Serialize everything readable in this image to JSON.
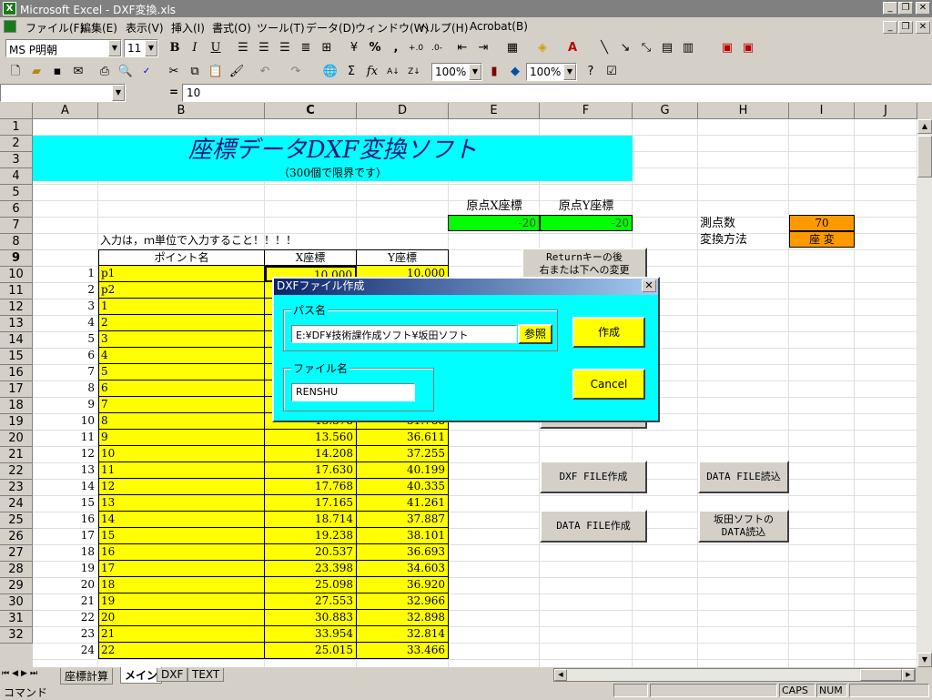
{
  "window": {
    "title": "Microsoft Excel - DXF変換.xls",
    "app_icon": "X"
  },
  "menu": [
    "ファイル(F)",
    "編集(E)",
    "表示(V)",
    "挿入(I)",
    "書式(O)",
    "ツール(T)",
    "データ(D)",
    "ウィンドウ(W)",
    "ヘルプ(H)",
    "Acrobat(B)"
  ],
  "format_toolbar": {
    "font": "MS P明朝",
    "size": "11"
  },
  "std_toolbar": {
    "zoom1": "100%",
    "zoom2": "100%"
  },
  "formula_bar": {
    "name_box": "",
    "equals": "=",
    "value": "10"
  },
  "columns": [
    "A",
    "B",
    "C",
    "D",
    "E",
    "F",
    "G",
    "H",
    "I",
    "J"
  ],
  "rows": [
    "1",
    "2",
    "3",
    "4",
    "5",
    "6",
    "7",
    "8",
    "9",
    "10",
    "11",
    "12",
    "13",
    "14",
    "15",
    "16",
    "17",
    "18",
    "19",
    "20",
    "21",
    "22",
    "23",
    "24",
    "25",
    "26",
    "27",
    "28",
    "29",
    "30",
    "31",
    "32"
  ],
  "sheet": {
    "title": "座標データDXF変換ソフト",
    "subtitle": "（300個で限界です）",
    "origin_x_label": "原点X座標",
    "origin_y_label": "原点Y座標",
    "origin_x": "-20",
    "origin_y": "-20",
    "point_count_label": "測点数",
    "point_count": "70",
    "method_label": "変換方法",
    "method": "座 変",
    "note": "入力は，ｍ単位で入力すること！！！！",
    "table_header": {
      "name": "ポイント名",
      "x": "X座標",
      "y": "Y座標"
    },
    "table_rows": [
      {
        "no": "1",
        "name": "p1",
        "x": "10.000",
        "y": "10.000"
      },
      {
        "no": "2",
        "name": "p2",
        "x": "",
        "y": ""
      },
      {
        "no": "3",
        "name": "1",
        "x": "",
        "y": ""
      },
      {
        "no": "4",
        "name": "2",
        "x": "",
        "y": ""
      },
      {
        "no": "5",
        "name": "3",
        "x": "",
        "y": ""
      },
      {
        "no": "6",
        "name": "4",
        "x": "",
        "y": ""
      },
      {
        "no": "7",
        "name": "5",
        "x": "",
        "y": ""
      },
      {
        "no": "8",
        "name": "6",
        "x": "",
        "y": ""
      },
      {
        "no": "9",
        "name": "7",
        "x": "",
        "y": ""
      },
      {
        "no": "10",
        "name": "8",
        "x": "13.378",
        "y": "31.788"
      },
      {
        "no": "11",
        "name": "9",
        "x": "13.560",
        "y": "36.611"
      },
      {
        "no": "12",
        "name": "10",
        "x": "14.208",
        "y": "37.255"
      },
      {
        "no": "13",
        "name": "11",
        "x": "17.630",
        "y": "40.199"
      },
      {
        "no": "14",
        "name": "12",
        "x": "17.768",
        "y": "40.335"
      },
      {
        "no": "15",
        "name": "13",
        "x": "17.165",
        "y": "41.261"
      },
      {
        "no": "16",
        "name": "14",
        "x": "18.714",
        "y": "37.887"
      },
      {
        "no": "17",
        "name": "15",
        "x": "19.238",
        "y": "38.101"
      },
      {
        "no": "18",
        "name": "16",
        "x": "20.537",
        "y": "36.693"
      },
      {
        "no": "19",
        "name": "17",
        "x": "23.398",
        "y": "34.603"
      },
      {
        "no": "20",
        "name": "18",
        "x": "25.098",
        "y": "36.920"
      },
      {
        "no": "21",
        "name": "19",
        "x": "27.553",
        "y": "32.966"
      },
      {
        "no": "22",
        "name": "20",
        "x": "30.883",
        "y": "32.898"
      },
      {
        "no": "23",
        "name": "21",
        "x": "33.954",
        "y": "32.814"
      },
      {
        "no": "24",
        "name": "22",
        "x": "25.015",
        "y": "33.466"
      }
    ],
    "return_button": "Returnキーの後\n右または下への変更",
    "buttons": {
      "dxf_create": "DXF FILE作成",
      "data_read": "DATA FILE読込",
      "data_create": "DATA FILE作成",
      "sakata_read": "坂田ソフトの\nDATA読込"
    }
  },
  "dialog": {
    "title": "DXFファイル作成",
    "path_group": "パス名",
    "path_value": "E:¥DF¥技術課作成ソフト¥坂田ソフト",
    "browse": "参照",
    "file_group": "ファイル名",
    "file_value": "RENSHU",
    "create": "作成",
    "cancel": "Cancel"
  },
  "tabs": [
    "座標計算",
    "メイン",
    "DXF",
    "TEXT"
  ],
  "active_tab": "メイン",
  "status": {
    "mode": "コマンド",
    "caps": "CAPS",
    "num": "NUM"
  },
  "colors": {
    "cyan": "#00ffff",
    "yellow": "#ffff00",
    "green": "#00ff00",
    "orange": "#ff9900"
  }
}
